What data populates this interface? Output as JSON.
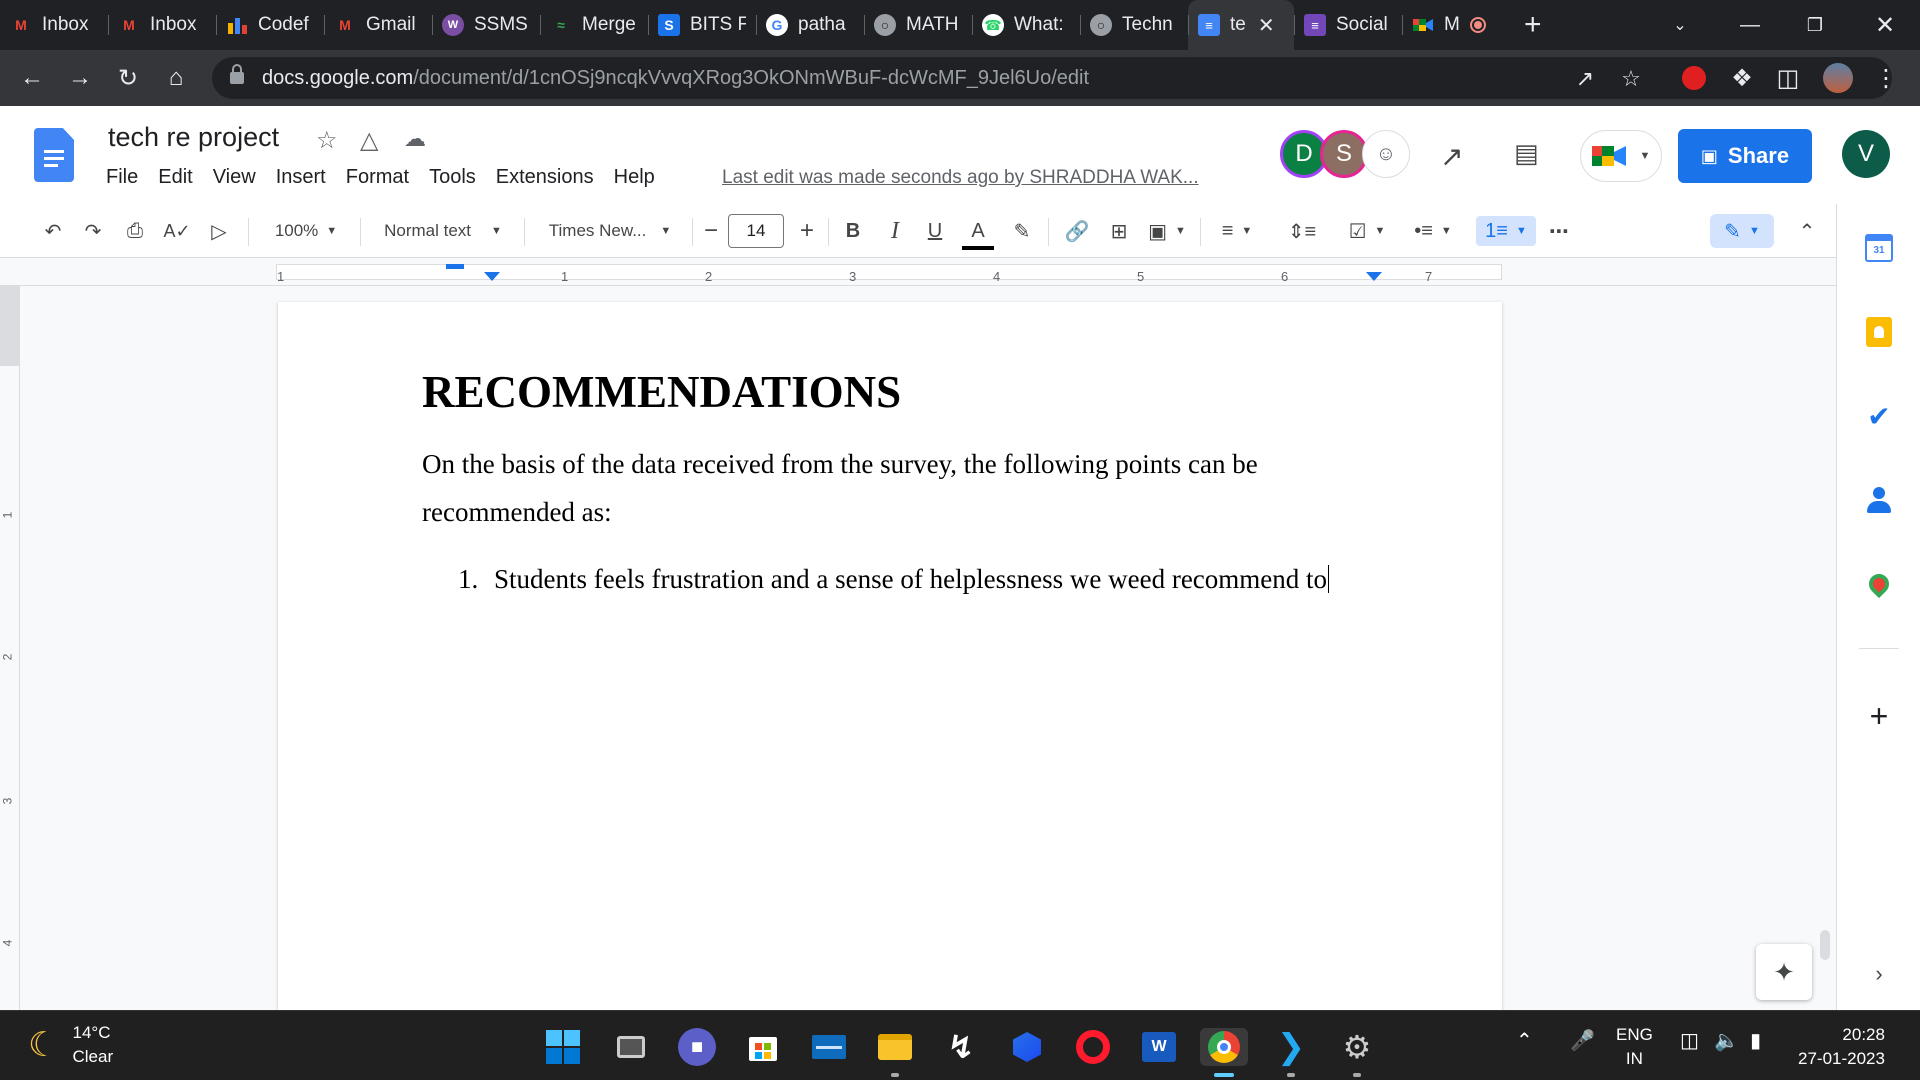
{
  "browser": {
    "tabs": [
      {
        "label": "Inbox",
        "icon": "gmail-icon"
      },
      {
        "label": "Inbox",
        "icon": "gmail-icon"
      },
      {
        "label": "Codef",
        "icon": "codeforces-icon"
      },
      {
        "label": "Gmail",
        "icon": "gmail-icon"
      },
      {
        "label": "SSMS",
        "icon": "ssms-icon"
      },
      {
        "label": "Merge",
        "icon": "merge-icon"
      },
      {
        "label": "BITS F",
        "icon": "bits-icon"
      },
      {
        "label": "patha",
        "icon": "google-icon"
      },
      {
        "label": "MATH",
        "icon": "globe-icon"
      },
      {
        "label": "What:",
        "icon": "whatsapp-icon"
      },
      {
        "label": "Techn",
        "icon": "globe-icon"
      },
      {
        "label": "te",
        "icon": "docs-icon",
        "active": true
      },
      {
        "label": "Social",
        "icon": "forms-icon"
      },
      {
        "label": "M",
        "icon": "meet-icon"
      }
    ],
    "url_host": "docs.google.com",
    "url_path": "/document/d/1cnOSj9ncqkVvvqXRog3OkONmWBuF-dcWcMF_9Jel6Uo/edit"
  },
  "docs": {
    "title": "tech re project",
    "menu": [
      "File",
      "Edit",
      "View",
      "Insert",
      "Format",
      "Tools",
      "Extensions",
      "Help"
    ],
    "last_edit": "Last edit was made seconds ago by SHRADDHA WAK...",
    "share_label": "Share",
    "avatars": [
      {
        "letter": "D",
        "color": "#0b8043"
      },
      {
        "letter": "S",
        "color": "#8d6e63"
      }
    ],
    "user_avatar": "V",
    "user_color": "#0d5c4a"
  },
  "toolbar": {
    "zoom": "100%",
    "style": "Normal text",
    "font": "Times New...",
    "font_size": "14",
    "bold": "B",
    "italic": "I",
    "underline": "U",
    "text_color": "A"
  },
  "ruler": {
    "h_numbers": [
      "1",
      "1",
      "2",
      "3",
      "4",
      "5",
      "6",
      "7"
    ],
    "v_numbers": [
      "1",
      "2",
      "3",
      "4"
    ]
  },
  "document": {
    "heading": "RECOMMENDATIONS",
    "paragraph": "On the basis of the data received from the survey, the following points can be recommended as:",
    "list_number": "1.",
    "list_item": "Students feels frustration and a sense of helplessness we weed recommend to"
  },
  "taskbar": {
    "temperature": "14°C",
    "condition": "Clear",
    "lang_top": "ENG",
    "lang_bottom": "IN",
    "time": "20:28",
    "date": "27-01-2023"
  },
  "colors": {
    "accent": "#1a73e8",
    "chrome_dark": "#202124",
    "chrome_mid": "#35363a"
  }
}
